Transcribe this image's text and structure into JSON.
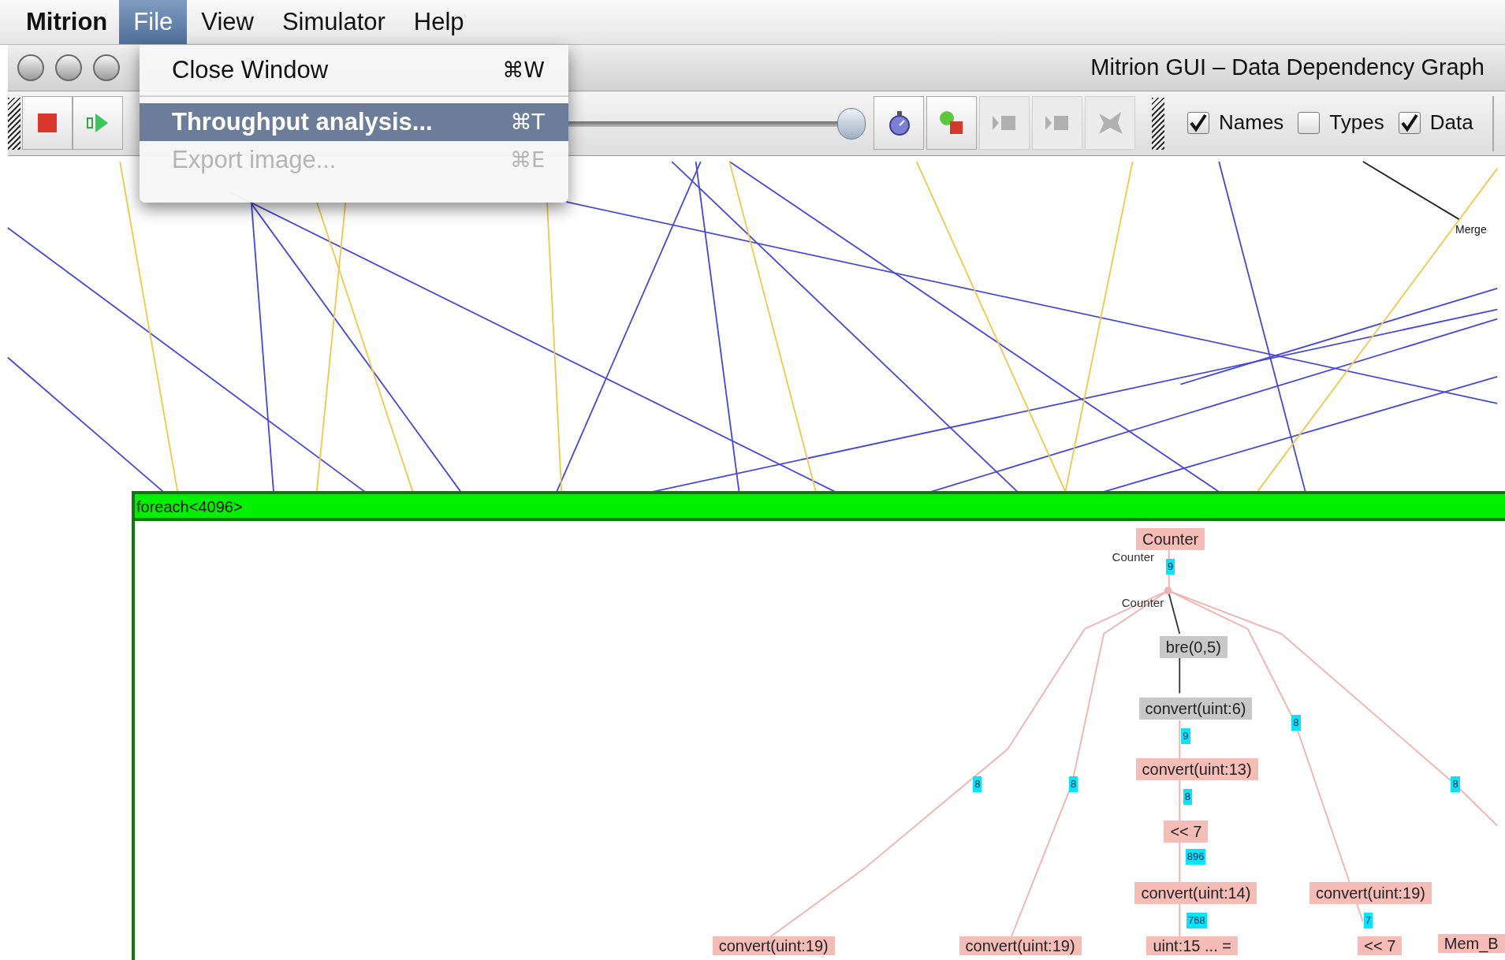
{
  "menu_bar": {
    "app": "Mitrion",
    "items": [
      {
        "label": "File",
        "selected": true
      },
      {
        "label": "View",
        "selected": false
      },
      {
        "label": "Simulator",
        "selected": false
      },
      {
        "label": "Help",
        "selected": false
      }
    ]
  },
  "file_menu": {
    "items": [
      {
        "kind": "item",
        "label": "Close Window",
        "shortcut": "⌘W",
        "selected": false,
        "disabled": false
      },
      {
        "kind": "separator"
      },
      {
        "kind": "item",
        "label": "Throughput analysis...",
        "shortcut": "⌘T",
        "selected": true,
        "disabled": false
      },
      {
        "kind": "item",
        "label": "Export image...",
        "shortcut": "⌘E",
        "selected": false,
        "disabled": true
      }
    ]
  },
  "window": {
    "title": "Mitrion GUI – Data Dependency Graph"
  },
  "toolbar": {
    "left_buttons": [
      {
        "kind": "stop",
        "disabled": false
      },
      {
        "kind": "run",
        "disabled": false
      }
    ],
    "slider": {
      "level": 1
    },
    "right_buttons": [
      {
        "kind": "stopwatch",
        "disabled": false
      },
      {
        "kind": "nodes",
        "disabled": false
      },
      {
        "kind": "step",
        "disabled": true
      },
      {
        "kind": "step",
        "disabled": true
      },
      {
        "kind": "reset",
        "disabled": true
      }
    ],
    "checkboxes": [
      {
        "label": "Names",
        "checked": true
      },
      {
        "label": "Types",
        "checked": false
      },
      {
        "label": "Data",
        "checked": true
      }
    ]
  },
  "graph": {
    "labels": [
      {
        "text": "Merge"
      }
    ],
    "loop": {
      "label": "foreach<4096>"
    },
    "nodes": [
      {
        "kind": "node",
        "label": "Counter",
        "color": "#f6bcb6"
      },
      {
        "kind": "port",
        "label": "Counter"
      },
      {
        "kind": "value",
        "label": "9"
      },
      {
        "kind": "port",
        "label": "Counter"
      },
      {
        "kind": "node",
        "label": "bre(0,5)",
        "color": "#c8c8c8"
      },
      {
        "kind": "node",
        "label": "convert(uint:6)",
        "color": "#c8c8c8"
      },
      {
        "kind": "value",
        "label": "9"
      },
      {
        "kind": "node",
        "label": "convert(uint:13)",
        "color": "#f6bcb6"
      },
      {
        "kind": "value",
        "label": "8"
      },
      {
        "kind": "value",
        "label": "8"
      },
      {
        "kind": "value",
        "label": "8"
      },
      {
        "kind": "value",
        "label": "8"
      },
      {
        "kind": "value",
        "label": "8"
      },
      {
        "kind": "node",
        "label": "<< 7",
        "color": "#f6bcb6"
      },
      {
        "kind": "value",
        "label": "896"
      },
      {
        "kind": "node",
        "label": "convert(uint:14)",
        "color": "#f6bcb6"
      },
      {
        "kind": "node",
        "label": "convert(uint:19)",
        "color": "#f6bcb6"
      },
      {
        "kind": "value",
        "label": "768"
      },
      {
        "kind": "value",
        "label": "7"
      },
      {
        "kind": "node",
        "label": "convert(uint:19)",
        "color": "#f6bcb6"
      },
      {
        "kind": "node",
        "label": "convert(uint:19)",
        "color": "#f6bcb6"
      },
      {
        "kind": "node",
        "label": "uint:15 ... =",
        "color": "#f6bcb6"
      },
      {
        "kind": "node",
        "label": "<< 7",
        "color": "#f6bcb6"
      },
      {
        "kind": "node",
        "label": "Mem_B",
        "color": "#f6bcb6"
      }
    ]
  }
}
